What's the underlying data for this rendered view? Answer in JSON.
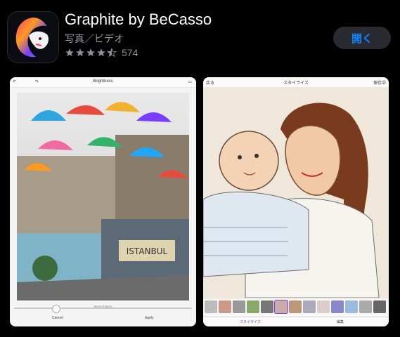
{
  "app": {
    "title": "Graphite by BeCasso",
    "category": "写真／ビデオ",
    "rating_count": "574",
    "rating": 4.5,
    "open_label": "開く"
  },
  "screenshot1": {
    "toolbar_title": "Brightness",
    "cancel_label": "Cancel",
    "apply_label": "Apply",
    "slider_value_label": "BRIGHTNESS"
  },
  "screenshot2": {
    "back_label": "戻る",
    "toolbar_title": "スタイライズ",
    "save_label": "保存中",
    "styles_tab": "スタイライズ",
    "edit_tab": "編集",
    "thumb_labels": [
      "",
      "",
      "",
      "",
      "",
      "",
      "",
      "",
      "",
      "",
      "",
      "",
      ""
    ]
  },
  "colors": {
    "accent": "#0a84ff",
    "button_bg": "#2a2b31",
    "secondary_text": "#8e8e93"
  }
}
